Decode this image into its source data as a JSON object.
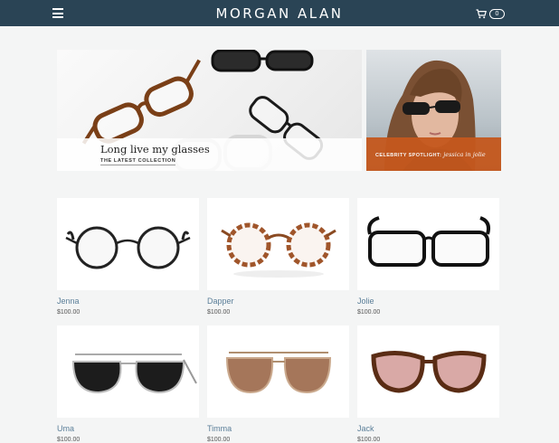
{
  "header": {
    "brand": "MORGAN ALAN",
    "cart_count": "0",
    "menu_icon": "hamburger-menu-icon",
    "cart_icon": "shopping-cart-icon"
  },
  "hero": {
    "main": {
      "title": "Long live my glasses",
      "subtitle": "THE LATEST COLLECTION"
    },
    "side": {
      "label": "CELEBRITY SPOTLIGHT:",
      "name": "jessica in jolie",
      "accent": "#c5581d"
    }
  },
  "products": [
    {
      "name": "Jenna",
      "price": "$100.00"
    },
    {
      "name": "Dapper",
      "price": "$100.00"
    },
    {
      "name": "Jolie",
      "price": "$100.00"
    },
    {
      "name": "Uma",
      "price": "$100.00"
    },
    {
      "name": "Timma",
      "price": "$100.00"
    },
    {
      "name": "Jack",
      "price": "$100.00"
    }
  ],
  "colors": {
    "nav": "#2a4455",
    "product_link": "#5b7f99",
    "background": "#f4f5f5"
  }
}
